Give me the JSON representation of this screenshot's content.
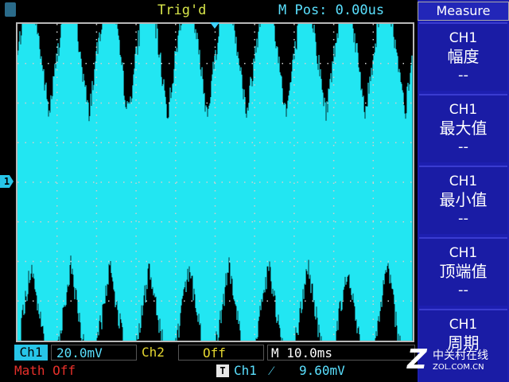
{
  "header": {
    "trigger_status": "Trig'd",
    "m_pos": "M Pos: 0.00us"
  },
  "menu": {
    "title": "Measure",
    "items": [
      {
        "channel": "CH1",
        "name": "幅度",
        "value": "--"
      },
      {
        "channel": "CH1",
        "name": "最大值",
        "value": "--"
      },
      {
        "channel": "CH1",
        "name": "最小值",
        "value": "--"
      },
      {
        "channel": "CH1",
        "name": "顶端值",
        "value": "--"
      },
      {
        "channel": "CH1",
        "name": "周期",
        "value": ""
      }
    ]
  },
  "status": {
    "ch1_label": "Ch1",
    "ch1_scale": "20.0mV",
    "ch2_label": "Ch2",
    "ch2_scale": "Off",
    "timebase": "M 10.0ms",
    "math": "Math Off",
    "trigger_icon": "T",
    "trigger_source": "Ch1",
    "trigger_edge": "rising-edge-icon",
    "trigger_edge_glyph": "⁄",
    "trigger_level": "9.60mV"
  },
  "screen": {
    "ch1_marker": "1",
    "waveform_color": "#22e6f2",
    "grid_color": "#cfcfcf",
    "bursts": 10
  },
  "watermark": {
    "logo_letter": "Z",
    "cn": "中关村在线",
    "url": "ZOL.COM.CN"
  }
}
